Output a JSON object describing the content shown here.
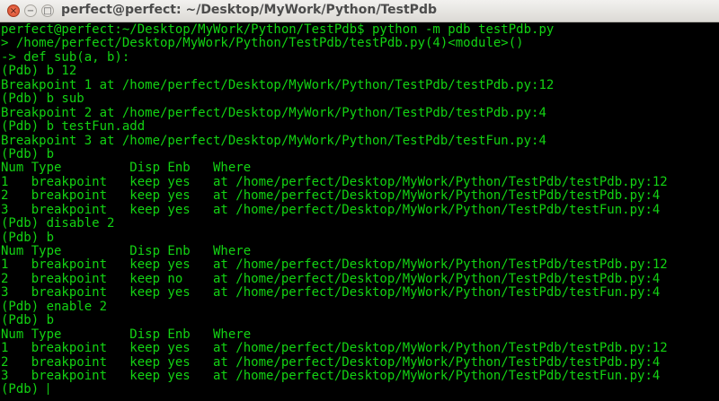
{
  "window": {
    "title": "perfect@perfect: ~/Desktop/MyWork/Python/TestPdb",
    "close_icon": "×",
    "minimize_icon": "−",
    "maximize_icon": "□"
  },
  "colors": {
    "text": "#13d313",
    "background": "#000000"
  },
  "terminal": {
    "lines": [
      "perfect@perfect:~/Desktop/MyWork/Python/TestPdb$ python -m pdb testPdb.py",
      "> /home/perfect/Desktop/MyWork/Python/TestPdb/testPdb.py(4)<module>()",
      "-> def sub(a, b):",
      "(Pdb) b 12",
      "Breakpoint 1 at /home/perfect/Desktop/MyWork/Python/TestPdb/testPdb.py:12",
      "(Pdb) b sub",
      "Breakpoint 2 at /home/perfect/Desktop/MyWork/Python/TestPdb/testPdb.py:4",
      "(Pdb) b testFun.add",
      "Breakpoint 3 at /home/perfect/Desktop/MyWork/Python/TestPdb/testFun.py:4",
      "(Pdb) b",
      "Num Type         Disp Enb   Where",
      "1   breakpoint   keep yes   at /home/perfect/Desktop/MyWork/Python/TestPdb/testPdb.py:12",
      "2   breakpoint   keep yes   at /home/perfect/Desktop/MyWork/Python/TestPdb/testPdb.py:4",
      "3   breakpoint   keep yes   at /home/perfect/Desktop/MyWork/Python/TestPdb/testFun.py:4",
      "(Pdb) disable 2",
      "(Pdb) b",
      "Num Type         Disp Enb   Where",
      "1   breakpoint   keep yes   at /home/perfect/Desktop/MyWork/Python/TestPdb/testPdb.py:12",
      "2   breakpoint   keep no    at /home/perfect/Desktop/MyWork/Python/TestPdb/testPdb.py:4",
      "3   breakpoint   keep yes   at /home/perfect/Desktop/MyWork/Python/TestPdb/testFun.py:4",
      "(Pdb) enable 2",
      "(Pdb) b",
      "Num Type         Disp Enb   Where",
      "1   breakpoint   keep yes   at /home/perfect/Desktop/MyWork/Python/TestPdb/testPdb.py:12",
      "2   breakpoint   keep yes   at /home/perfect/Desktop/MyWork/Python/TestPdb/testPdb.py:4",
      "3   breakpoint   keep yes   at /home/perfect/Desktop/MyWork/Python/TestPdb/testFun.py:4"
    ],
    "prompt": "(Pdb) "
  }
}
